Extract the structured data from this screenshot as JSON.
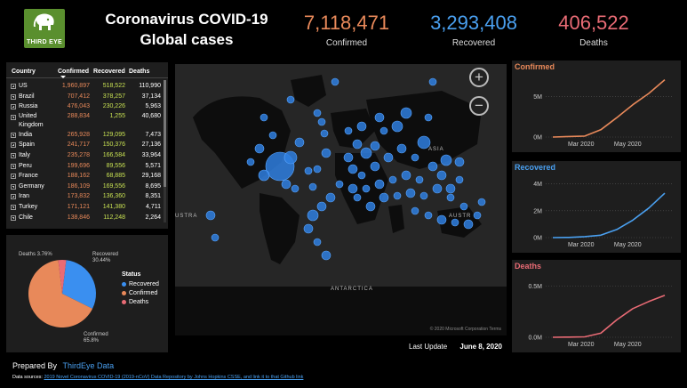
{
  "logo": {
    "text": "THIRD EYE"
  },
  "title": {
    "line1": "Coronavirus COVID-19",
    "line2": "Global cases"
  },
  "kpis": {
    "confirmed": {
      "value": "7,118,471",
      "label": "Confirmed",
      "color": "#e8895a"
    },
    "recovered": {
      "value": "3,293,408",
      "label": "Recovered",
      "color": "#4aa0f0"
    },
    "deaths": {
      "value": "406,522",
      "label": "Deaths",
      "color": "#e96b75"
    }
  },
  "table": {
    "columns": [
      "Country",
      "Confirmed",
      "Recovered",
      "Deaths"
    ],
    "rows": [
      {
        "country": "US",
        "confirmed": "1,960,897",
        "recovered": "518,522",
        "deaths": "110,990"
      },
      {
        "country": "Brazil",
        "confirmed": "707,412",
        "recovered": "378,257",
        "deaths": "37,134"
      },
      {
        "country": "Russia",
        "confirmed": "476,043",
        "recovered": "230,226",
        "deaths": "5,963"
      },
      {
        "country": "United Kingdom",
        "confirmed": "288,834",
        "recovered": "1,255",
        "deaths": "40,680"
      },
      {
        "country": "India",
        "confirmed": "265,928",
        "recovered": "129,095",
        "deaths": "7,473"
      },
      {
        "country": "Spain",
        "confirmed": "241,717",
        "recovered": "150,376",
        "deaths": "27,136"
      },
      {
        "country": "Italy",
        "confirmed": "235,278",
        "recovered": "166,584",
        "deaths": "33,964"
      },
      {
        "country": "Peru",
        "confirmed": "199,696",
        "recovered": "89,556",
        "deaths": "5,571"
      },
      {
        "country": "France",
        "confirmed": "188,162",
        "recovered": "68,885",
        "deaths": "29,168"
      },
      {
        "country": "Germany",
        "confirmed": "186,109",
        "recovered": "169,556",
        "deaths": "8,695"
      },
      {
        "country": "Iran",
        "confirmed": "173,832",
        "recovered": "136,360",
        "deaths": "8,351"
      },
      {
        "country": "Turkey",
        "confirmed": "171,121",
        "recovered": "141,380",
        "deaths": "4,711"
      },
      {
        "country": "Chile",
        "confirmed": "138,846",
        "recovered": "112,248",
        "deaths": "2,264"
      }
    ]
  },
  "pie": {
    "legend_title": "Status",
    "slices": [
      {
        "name": "Recovered",
        "pct": 30.44,
        "label": "Recovered\n30.44%",
        "color": "#3a8ff0"
      },
      {
        "name": "Confirmed",
        "pct": 65.8,
        "label": "Confirmed\n65.8%",
        "color": "#e8895a"
      },
      {
        "name": "Deaths",
        "pct": 3.76,
        "label": "Deaths 3.76%",
        "color": "#e96b75"
      }
    ]
  },
  "map": {
    "zoom_in": "+",
    "zoom_out": "−",
    "ocean_labels": [
      "ANTARCTICA",
      "ASIA",
      "AUSTR",
      "USTRA"
    ],
    "attribution": "© 2020 Microsoft Corporation  Terms"
  },
  "last_update": {
    "label": "Last Update",
    "date": "June 8, 2020"
  },
  "line_charts": [
    {
      "title": "Confirmed",
      "color": "#e8895a",
      "y_ticks": [
        "5M",
        "0M"
      ],
      "x_ticks": [
        "Mar 2020",
        "May 2020"
      ],
      "chart_data": {
        "type": "line",
        "x": [
          "Jan 22",
          "Feb 15",
          "Mar 10",
          "Apr 1",
          "Apr 20",
          "May 10",
          "May 25",
          "Jun 8"
        ],
        "values": [
          0.001,
          0.07,
          0.12,
          0.9,
          2.4,
          4.0,
          5.4,
          7.1
        ],
        "ylim": [
          0,
          7.5
        ]
      }
    },
    {
      "title": "Recovered",
      "color": "#4aa0f0",
      "y_ticks": [
        "4M",
        "2M",
        "0M"
      ],
      "x_ticks": [
        "Mar 2020",
        "May 2020"
      ],
      "chart_data": {
        "type": "line",
        "x": [
          "Jan 22",
          "Feb 15",
          "Mar 10",
          "Apr 1",
          "Apr 20",
          "May 10",
          "May 25",
          "Jun 8"
        ],
        "values": [
          0.0,
          0.01,
          0.07,
          0.18,
          0.6,
          1.3,
          2.2,
          3.3
        ],
        "ylim": [
          0,
          4.5
        ]
      }
    },
    {
      "title": "Deaths",
      "color": "#e96b75",
      "y_ticks": [
        "0.5M",
        "0.0M"
      ],
      "x_ticks": [
        "Mar 2020",
        "May 2020"
      ],
      "chart_data": {
        "type": "line",
        "x": [
          "Jan 22",
          "Feb 15",
          "Mar 10",
          "Apr 1",
          "Apr 20",
          "May 10",
          "May 25",
          "Jun 8"
        ],
        "values": [
          0.0,
          0.002,
          0.004,
          0.04,
          0.17,
          0.28,
          0.35,
          0.41
        ],
        "ylim": [
          0,
          0.6
        ]
      }
    }
  ],
  "footer": {
    "prepared_by": "Prepared By",
    "prepared_link": "ThirdEye Data",
    "sources_label": "Data sources:",
    "sources_link": "2019 Novel Coronavirus COVID-19 (2019-nCoV) Data Repository by Johns Hopkins CSSE, and link it to that Github link"
  }
}
